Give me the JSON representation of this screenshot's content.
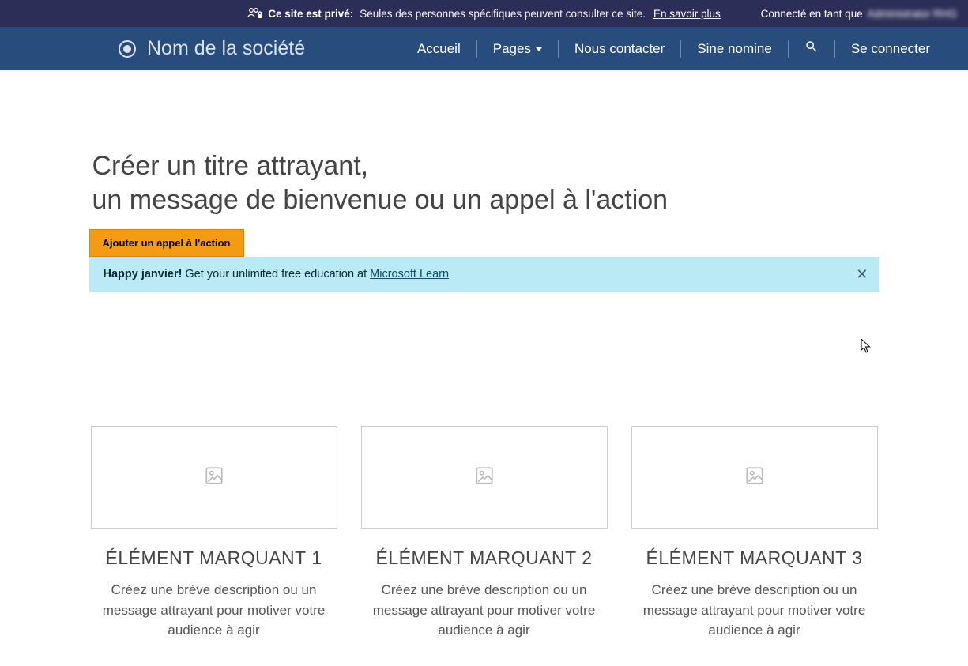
{
  "banner": {
    "bold": "Ce site est privé:",
    "text": "Seules des personnes spécifiques peuvent consulter ce site.",
    "link": "En savoir plus",
    "connected_as": "Connecté en tant que",
    "user": "Administrator RHG"
  },
  "nav": {
    "brand": "Nom de la société",
    "items": [
      "Accueil",
      "Pages",
      "Nous contacter",
      "Sine nomine",
      "Se connecter"
    ]
  },
  "hero": {
    "line1": "Créer un titre attrayant,",
    "line2": "un message de bienvenue ou un appel à l'action",
    "cta": "Ajouter un appel à l'action"
  },
  "alert": {
    "bold": "Happy janvier!",
    "text": "Get your unlimited free education at",
    "link": "Microsoft Learn"
  },
  "cards": [
    {
      "title": "ÉLÉMENT MARQUANT 1",
      "desc": "Créez une brève description ou un message attrayant pour motiver votre audience à agir"
    },
    {
      "title": "ÉLÉMENT MARQUANT 2",
      "desc": "Créez une brève description ou un message attrayant pour motiver votre audience à agir"
    },
    {
      "title": "ÉLÉMENT MARQUANT 3",
      "desc": "Créez une brève description ou un message attrayant pour motiver votre audience à agir"
    }
  ]
}
